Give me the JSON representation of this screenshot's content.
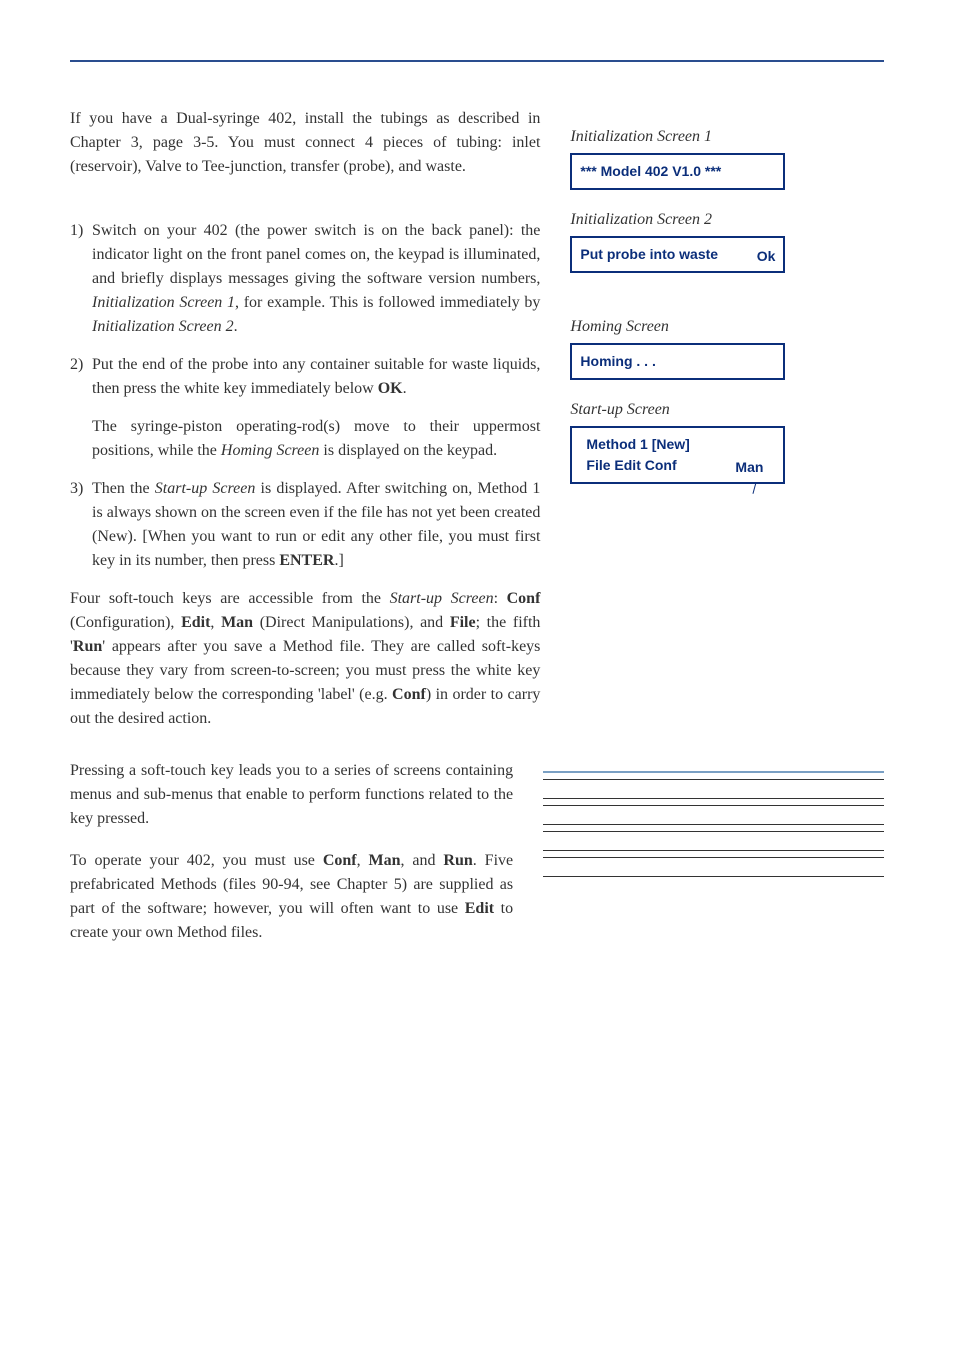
{
  "intro": "If you have a Dual-syringe 402, install the tubings as described in Chapter 3, page 3-5. You must connect 4 pieces of tubing: inlet (reservoir), Valve to Tee-junction, transfer (probe), and waste.",
  "steps": {
    "s1a": "1)",
    "s1b_pre": "Switch on your 402 (the power switch is on the back panel): the indicator light on the front panel comes on, the keypad is illuminated, and briefly displays messages giving the software version numbers, ",
    "s1b_em1": "Initialization Screen 1",
    "s1b_mid": ", for example. This is followed immediately by ",
    "s1b_em2": "Initialization Screen 2",
    "s1b_post": ".",
    "s2a": "2)",
    "s2b_pre": "Put the end of the probe into any container suitable for waste liquids, then press the white key immediately below ",
    "s2b_bold": "OK",
    "s2b_post": ".",
    "s2sub_pre": "The syringe-piston operating-rod(s) move to their uppermost positions, while the ",
    "s2sub_em": "Homing Screen",
    "s2sub_post": " is displayed on the keypad.",
    "s3a": "3)",
    "s3b_pre": "Then the ",
    "s3b_em": "Start-up Screen",
    "s3b_mid": " is displayed. After switching on, Method 1 is always shown on the screen even if the file has not yet been created (New). [When you want to run or edit any other file, you must first key in its number, then press ",
    "s3b_bold": "ENTER",
    "s3b_post": ".]"
  },
  "para4": {
    "pre": "Four soft-touch keys are accessible from the ",
    "em1": "Start-up Screen",
    "mid1": ": ",
    "b1": "Conf",
    "mid2": " (Configuration), ",
    "b2": "Edit",
    "mid3": ", ",
    "b3": "Man",
    "mid4": " (Direct Manipulations), and ",
    "b4": "File",
    "mid5": "; the fifth '",
    "b5": "Run",
    "mid6": "' appears after you save a Method file. They are called soft-keys because they vary from screen-to-screen; you must press the white key immediately below the corresponding 'label' (e.g. ",
    "b6": "Conf",
    "post": ") in order to carry out the desired action."
  },
  "para5": "Pressing a soft-touch key leads you to a series of screens containing menus and sub-menus that enable to perform functions related to the key pressed.",
  "para6": {
    "pre": "To operate your 402, you must use ",
    "b1": "Conf",
    "mid1": ", ",
    "b2": "Man",
    "mid2": ", and ",
    "b3": "Run",
    "mid3": ". Five prefabricated Methods (files 90-94, see Chapter 5) are supplied as part of the software; however, you will often want to use ",
    "b4": "Edit",
    "post": " to create your own Method files."
  },
  "screens": {
    "init1_label": "Initialization Screen 1",
    "init1_text": "***  Model 402 V1.0  ***",
    "init2_label": "Initialization Screen 2",
    "init2_line1": "Put probe into waste",
    "init2_ok": "Ok",
    "homing_label": "Homing Screen",
    "homing_text": "Homing . . .",
    "startup_label": "Start-up Screen",
    "startup_line1": "Method  1     [New]",
    "startup_line2": "File Edit Conf",
    "startup_man": "Man"
  }
}
